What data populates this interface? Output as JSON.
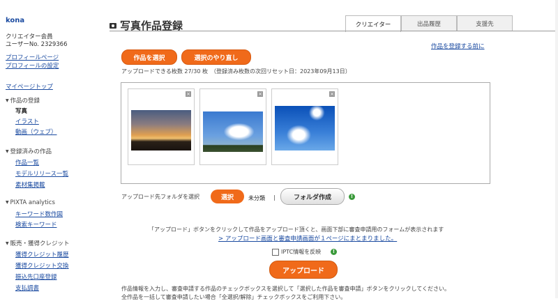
{
  "sidebar": {
    "logo": "kona",
    "member_type": "クリエイター会員",
    "user_no": "ユーザーNo. 2329366",
    "links_top": [
      "プロフィールページ",
      "プロフィールの設定"
    ],
    "mypage_top": "マイページトップ",
    "sections": [
      {
        "title": "作品の登録",
        "items": [
          {
            "label": "写真",
            "current": true
          },
          {
            "label": "イラスト",
            "current": false
          },
          {
            "label": "動画（ウェブ）",
            "current": false
          }
        ]
      },
      {
        "title": "登録済みの作品",
        "items": [
          {
            "label": "作品一覧",
            "current": false
          },
          {
            "label": "モデルリリース一覧",
            "current": false
          },
          {
            "label": "素材集掲載",
            "current": false
          }
        ]
      },
      {
        "title": "PIXTA analytics",
        "items": [
          {
            "label": "キーワード数作図",
            "current": false
          },
          {
            "label": "検索キーワード",
            "current": false
          }
        ]
      },
      {
        "title": "販売・獲得クレジット",
        "items": [
          {
            "label": "獲得クレジット履歴",
            "current": false
          },
          {
            "label": "獲得クレジット交換",
            "current": false
          },
          {
            "label": "振込先口座登録",
            "current": false
          },
          {
            "label": "支払調書",
            "current": false
          }
        ]
      }
    ]
  },
  "header": {
    "title": "写真作品登録",
    "tabs": [
      {
        "label": "クリエイター",
        "active": true
      },
      {
        "label": "出品履歴",
        "active": false
      },
      {
        "label": "支援先",
        "active": false
      }
    ]
  },
  "main": {
    "select_work_btn": "作品を選択",
    "redo_select_btn": "選択のやり直し",
    "before_register_link": "作品を登録する前に",
    "upload_count_note": "アップロードできる枚数 27/30 枚　（登録済み枚数の次回リセット日：2023年09月13日）",
    "upload_folder_label": "アップロード先フォルダを選択",
    "folder_select_btn": "選択",
    "folder_value": "未分類",
    "folder_sep": "|",
    "folder_create_btn": "フォルダ作成",
    "upload_instruction": "「アップロード」ボタンをクリックして作品をアップロード頂くと、画面下部に審査申請用のフォームが表示されます",
    "upload_link": "> アップロード画面と審査申請画面が１ページにまとまりました。",
    "iptc_label": "IPTC情報を反映",
    "upload_btn": "アップロード",
    "bottom_instruction1": "作品情報を入力し、審査申請する作品のチェックボックスを選択して「選択した作品を審査申請」ボタンをクリックしてください。",
    "bottom_instruction2": "全作品を一括して審査申請したい場合「全選択/解除」チェックボックスをご利用下さい。"
  },
  "thumbnails": [
    {
      "name": "sunset-skyline",
      "close": "×"
    },
    {
      "name": "cumulus-cloud",
      "close": "×"
    },
    {
      "name": "blue-sky-sun",
      "close": "×"
    }
  ]
}
